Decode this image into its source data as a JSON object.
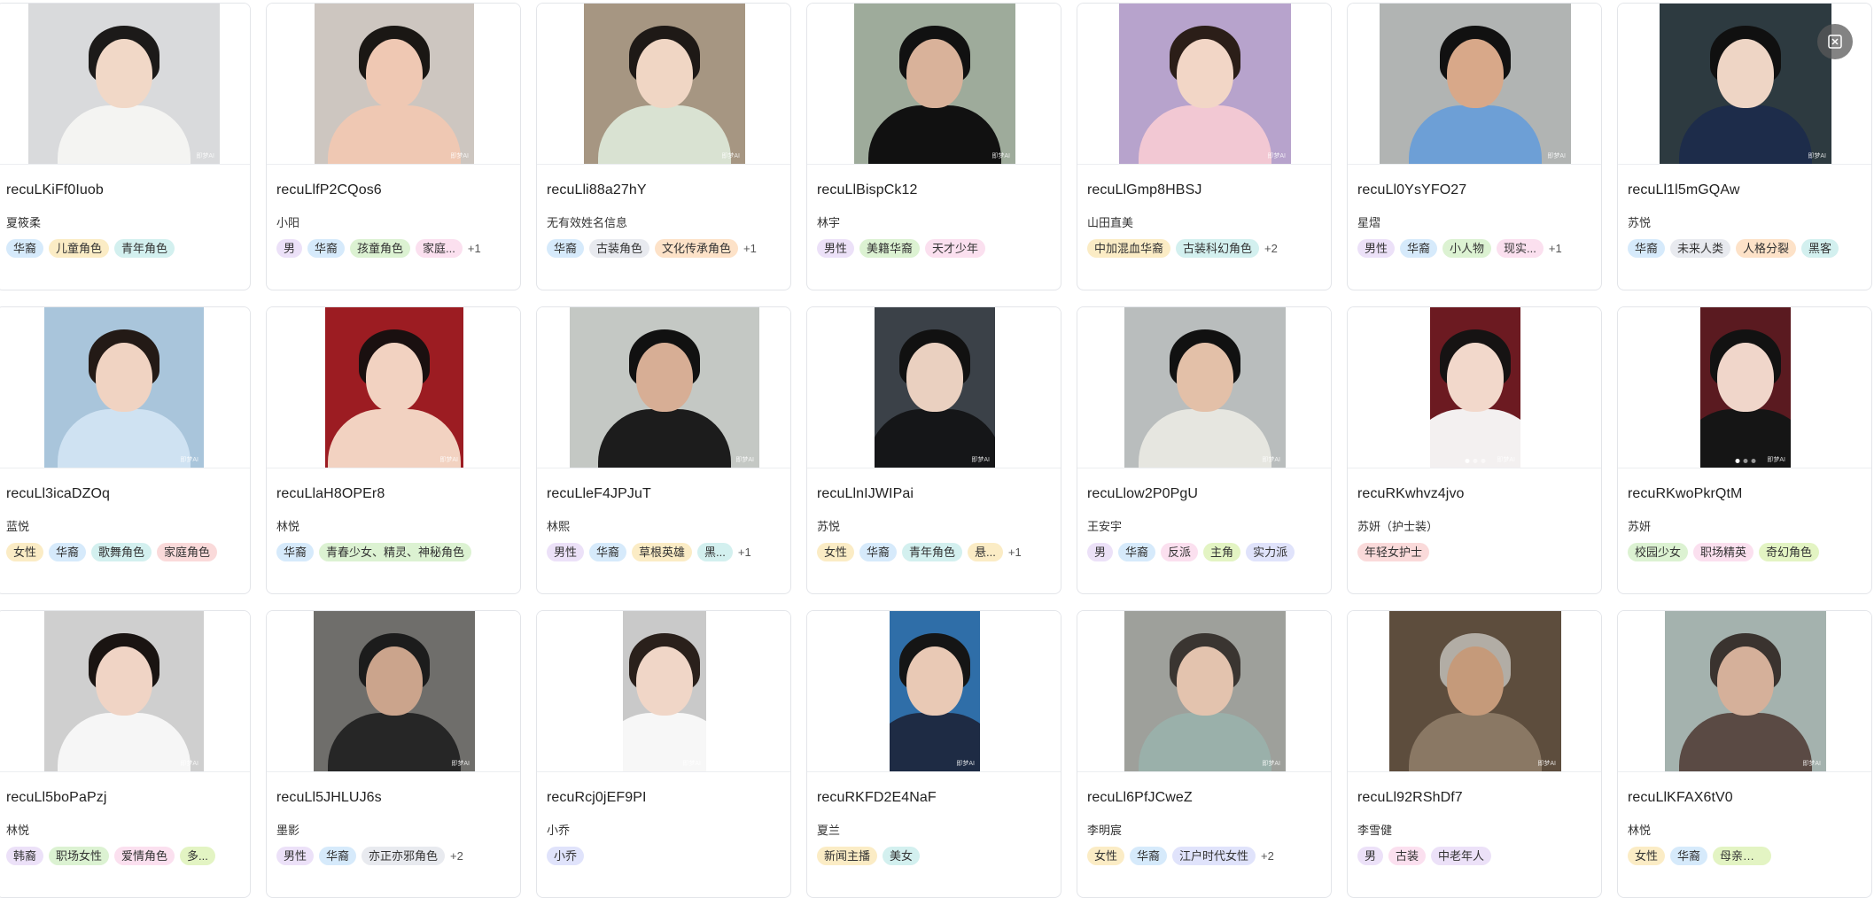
{
  "cards": [
    {
      "id": "recuLKiFf0Iuob",
      "name": "夏筱柔",
      "tags": [
        {
          "t": "华裔",
          "c": "c-blue"
        },
        {
          "t": "儿童角色",
          "c": "c-yellow"
        },
        {
          "t": "青年角色",
          "c": "c-cyan"
        }
      ],
      "more": "",
      "photo": {
        "bg": "#d9dadc",
        "skin": "#f1d8c7",
        "hair": "#1c1a19",
        "cloth": "#f4f4f2"
      }
    },
    {
      "id": "recuLlfP2CQos6",
      "name": "小阳",
      "tags": [
        {
          "t": "男",
          "c": "c-purple"
        },
        {
          "t": "华裔",
          "c": "c-blue"
        },
        {
          "t": "孩童角色",
          "c": "c-green"
        },
        {
          "t": "家庭...",
          "c": "c-pink"
        }
      ],
      "more": "+1",
      "photo": {
        "bg": "#cdc6c0",
        "skin": "#efc8b3",
        "hair": "#1a1714",
        "cloth": "#efc8b3"
      }
    },
    {
      "id": "recuLli88a27hY",
      "name": "无有效姓名信息",
      "tags": [
        {
          "t": "华裔",
          "c": "c-blue"
        },
        {
          "t": "古装角色",
          "c": "c-gray"
        },
        {
          "t": "文化传承角色",
          "c": "c-orange"
        }
      ],
      "more": "+1",
      "photo": {
        "bg": "#a69682",
        "skin": "#f0d6c4",
        "hair": "#1e1916",
        "cloth": "#d9e2d2"
      }
    },
    {
      "id": "recuLlBispCk12",
      "name": "林宇",
      "tags": [
        {
          "t": "男性",
          "c": "c-purple"
        },
        {
          "t": "美籍华裔",
          "c": "c-green"
        },
        {
          "t": "天才少年",
          "c": "c-pink"
        }
      ],
      "more": "",
      "photo": {
        "bg": "#9eab9b",
        "skin": "#d9b29a",
        "hair": "#111",
        "cloth": "#111"
      }
    },
    {
      "id": "recuLlGmp8HBSJ",
      "name": "山田直美",
      "tags": [
        {
          "t": "中加混血华裔",
          "c": "c-yellow"
        },
        {
          "t": "古装科幻角色",
          "c": "c-cyan"
        }
      ],
      "more": "+2",
      "photo": {
        "bg": "#b7a3cc",
        "skin": "#f2d6c6",
        "hair": "#2b1e18",
        "cloth": "#f2c8d3"
      }
    },
    {
      "id": "recuLl0YsYFO27",
      "name": "星熠",
      "tags": [
        {
          "t": "男性",
          "c": "c-purple"
        },
        {
          "t": "华裔",
          "c": "c-blue"
        },
        {
          "t": "小人物",
          "c": "c-green"
        },
        {
          "t": "现实...",
          "c": "c-pink"
        }
      ],
      "more": "+1",
      "photo": {
        "bg": "#b1b4b3",
        "skin": "#d8a889",
        "hair": "#111",
        "cloth": "#6d9fd6"
      }
    },
    {
      "id": "recuLl1l5mGQAw",
      "name": "苏悦",
      "tags": [
        {
          "t": "华裔",
          "c": "c-blue"
        },
        {
          "t": "未来人类",
          "c": "c-gray"
        },
        {
          "t": "人格分裂",
          "c": "c-orange"
        },
        {
          "t": "黑客",
          "c": "c-cyan"
        }
      ],
      "more": "",
      "photo": {
        "bg": "#2d3a40",
        "skin": "#eed5c5",
        "hair": "#101010",
        "cloth": "#1d2c4a"
      }
    },
    {
      "id": "recuLl3icaDZOq",
      "name": "蓝悦",
      "tags": [
        {
          "t": "女性",
          "c": "c-yellow"
        },
        {
          "t": "华裔",
          "c": "c-blue"
        },
        {
          "t": "歌舞角色",
          "c": "c-cyan"
        },
        {
          "t": "家庭角色",
          "c": "c-red"
        }
      ],
      "more": "",
      "photo": {
        "bg": "#a9c5db",
        "skin": "#f0d3c2",
        "hair": "#231a16",
        "cloth": "#cfe2f2"
      }
    },
    {
      "id": "recuLlaH8OPEr8",
      "name": "林悦",
      "tags": [
        {
          "t": "华裔",
          "c": "c-blue"
        },
        {
          "t": "青春少女、精灵、神秘角色",
          "c": "c-green"
        }
      ],
      "more": "",
      "photo": {
        "bg": "#9c1c22",
        "skin": "#f2d2c1",
        "hair": "#1a1010",
        "cloth": "#f2d2c1"
      }
    },
    {
      "id": "recuLleF4JPJuT",
      "name": "林熙",
      "tags": [
        {
          "t": "男性",
          "c": "c-purple"
        },
        {
          "t": "华裔",
          "c": "c-blue"
        },
        {
          "t": "草根英雄",
          "c": "c-yellow"
        },
        {
          "t": "黑...",
          "c": "c-cyan"
        }
      ],
      "more": "+1",
      "photo": {
        "bg": "#c4c8c4",
        "skin": "#d7ae95",
        "hair": "#111",
        "cloth": "#1c1c1c"
      }
    },
    {
      "id": "recuLlnIJWIPai",
      "name": "苏悦",
      "tags": [
        {
          "t": "女性",
          "c": "c-yellow"
        },
        {
          "t": "华裔",
          "c": "c-blue"
        },
        {
          "t": "青年角色",
          "c": "c-cyan"
        },
        {
          "t": "悬...",
          "c": "c-yellow"
        }
      ],
      "more": "+1",
      "photo": {
        "bg": "#3b4148",
        "skin": "#ead0c0",
        "hair": "#111",
        "cloth": "#151618"
      }
    },
    {
      "id": "recuLlow2P0PgU",
      "name": "王安宇",
      "tags": [
        {
          "t": "男",
          "c": "c-purple"
        },
        {
          "t": "华裔",
          "c": "c-blue"
        },
        {
          "t": "反派",
          "c": "c-pink"
        },
        {
          "t": "主角",
          "c": "c-lime"
        },
        {
          "t": "实力派",
          "c": "c-indigo"
        }
      ],
      "more": "",
      "photo": {
        "bg": "#b9bdbd",
        "skin": "#e3c0a8",
        "hair": "#111",
        "cloth": "#e6e6e0"
      }
    },
    {
      "id": "recuRKwhvz4jvo",
      "name": "苏妍（护士装）",
      "tags": [
        {
          "t": "年轻女护士",
          "c": "c-red"
        }
      ],
      "more": "",
      "photo": {
        "bg": "#6c1a21",
        "skin": "#f2d8cb",
        "hair": "#161313",
        "cloth": "#f3f0f0",
        "dots": true
      }
    },
    {
      "id": "recuRKwoPkrQtM",
      "name": "苏妍",
      "tags": [
        {
          "t": "校园少女",
          "c": "c-green"
        },
        {
          "t": "职场精英",
          "c": "c-pink"
        },
        {
          "t": "奇幻角色",
          "c": "c-lime"
        }
      ],
      "more": "",
      "photo": {
        "bg": "#5a1a20",
        "skin": "#f0d6ca",
        "hair": "#121212",
        "cloth": "#151515",
        "dots": true
      }
    },
    {
      "id": "recuLl5boPaPzj",
      "name": "林悦",
      "tags": [
        {
          "t": "韩裔",
          "c": "c-purple"
        },
        {
          "t": "职场女性",
          "c": "c-green"
        },
        {
          "t": "爱情角色",
          "c": "c-pink"
        },
        {
          "t": "多...",
          "c": "c-lime"
        }
      ],
      "more": "",
      "photo": {
        "bg": "#cfcfcf",
        "skin": "#f0d4c5",
        "hair": "#1a1412",
        "cloth": "#f6f6f6"
      }
    },
    {
      "id": "recuLl5JHLUJ6s",
      "name": "墨影",
      "tags": [
        {
          "t": "男性",
          "c": "c-purple"
        },
        {
          "t": "华裔",
          "c": "c-blue"
        },
        {
          "t": "亦正亦邪角色",
          "c": "c-gray"
        }
      ],
      "more": "+2",
      "photo": {
        "bg": "#6f6e6b",
        "skin": "#cba48c",
        "hair": "#1c1c1c",
        "cloth": "#262626"
      }
    },
    {
      "id": "recuRcj0jEF9PI",
      "name": "小乔",
      "tags": [
        {
          "t": "小乔",
          "c": "c-indigo"
        }
      ],
      "more": "",
      "photo": {
        "bg": "#c9c9c9",
        "skin": "#f0d6c7",
        "hair": "#2a201b",
        "cloth": "#f7f7f7"
      }
    },
    {
      "id": "recuRKFD2E4NaF",
      "name": "夏兰",
      "tags": [
        {
          "t": "新闻主播",
          "c": "c-yellow"
        },
        {
          "t": "美女",
          "c": "c-cyan"
        }
      ],
      "more": "",
      "photo": {
        "bg": "#2f6ea8",
        "skin": "#e9c9b5",
        "hair": "#151515",
        "cloth": "#1e2b44"
      }
    },
    {
      "id": "recuLl6PfJCweZ",
      "name": "李明宸",
      "tags": [
        {
          "t": "女性",
          "c": "c-yellow"
        },
        {
          "t": "华裔",
          "c": "c-blue"
        },
        {
          "t": "江户时代女性",
          "c": "c-indigo"
        }
      ],
      "more": "+2",
      "photo": {
        "bg": "#9ea09b",
        "skin": "#e3c3ae",
        "hair": "#3a3531",
        "cloth": "#9ab0aa"
      }
    },
    {
      "id": "recuLl92RShDf7",
      "name": "李雪健",
      "tags": [
        {
          "t": "男",
          "c": "c-purple"
        },
        {
          "t": "古装",
          "c": "c-pink"
        },
        {
          "t": "中老年人",
          "c": "c-purple"
        }
      ],
      "more": "",
      "photo": {
        "bg": "#5d4d3d",
        "skin": "#c59a7a",
        "hair": "#b2ada5",
        "cloth": "#8a7864"
      }
    },
    {
      "id": "recuLlKFAX6tV0",
      "name": "林悦",
      "tags": [
        {
          "t": "女性",
          "c": "c-yellow"
        },
        {
          "t": "华裔",
          "c": "c-blue"
        },
        {
          "t": "母亲、老妇人、家族...",
          "c": "c-lime"
        }
      ],
      "more": "",
      "photo": {
        "bg": "#a4b2ae",
        "skin": "#d5b09a",
        "hair": "#3a332f",
        "cloth": "#5a4a44"
      }
    }
  ],
  "watermark": "即梦AI",
  "close_icon": "fullscreen-exit-icon"
}
